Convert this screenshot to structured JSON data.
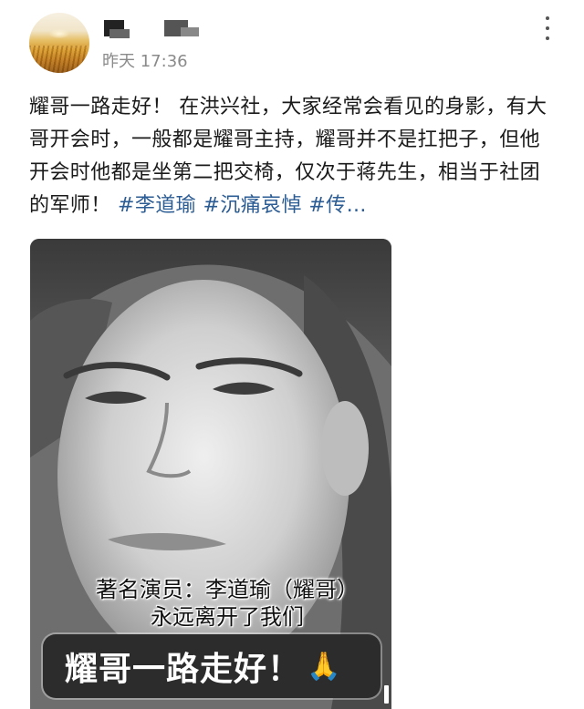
{
  "post": {
    "timestamp": "昨天 17:36",
    "text_main": "耀哥一路走好！ 在洪兴社，大家经常会看见的身影，有大哥开会时，一般都是耀哥主持，耀哥并不是扛把子，但他开会时他都是坐第二把交椅，仅次于蒋先生，相当于社团的军师！",
    "hashtags": [
      "#李道瑜",
      "#沉痛哀悼",
      "#传…"
    ]
  },
  "media": {
    "caption_line1": "著名演员：李道瑜（耀哥）",
    "caption_line2": "永远离开了我们",
    "banner_text": "耀哥一路走好！",
    "banner_emoji": "🙏"
  },
  "icons": {
    "more": "more-vertical-icon",
    "pause": "pause-icon"
  }
}
